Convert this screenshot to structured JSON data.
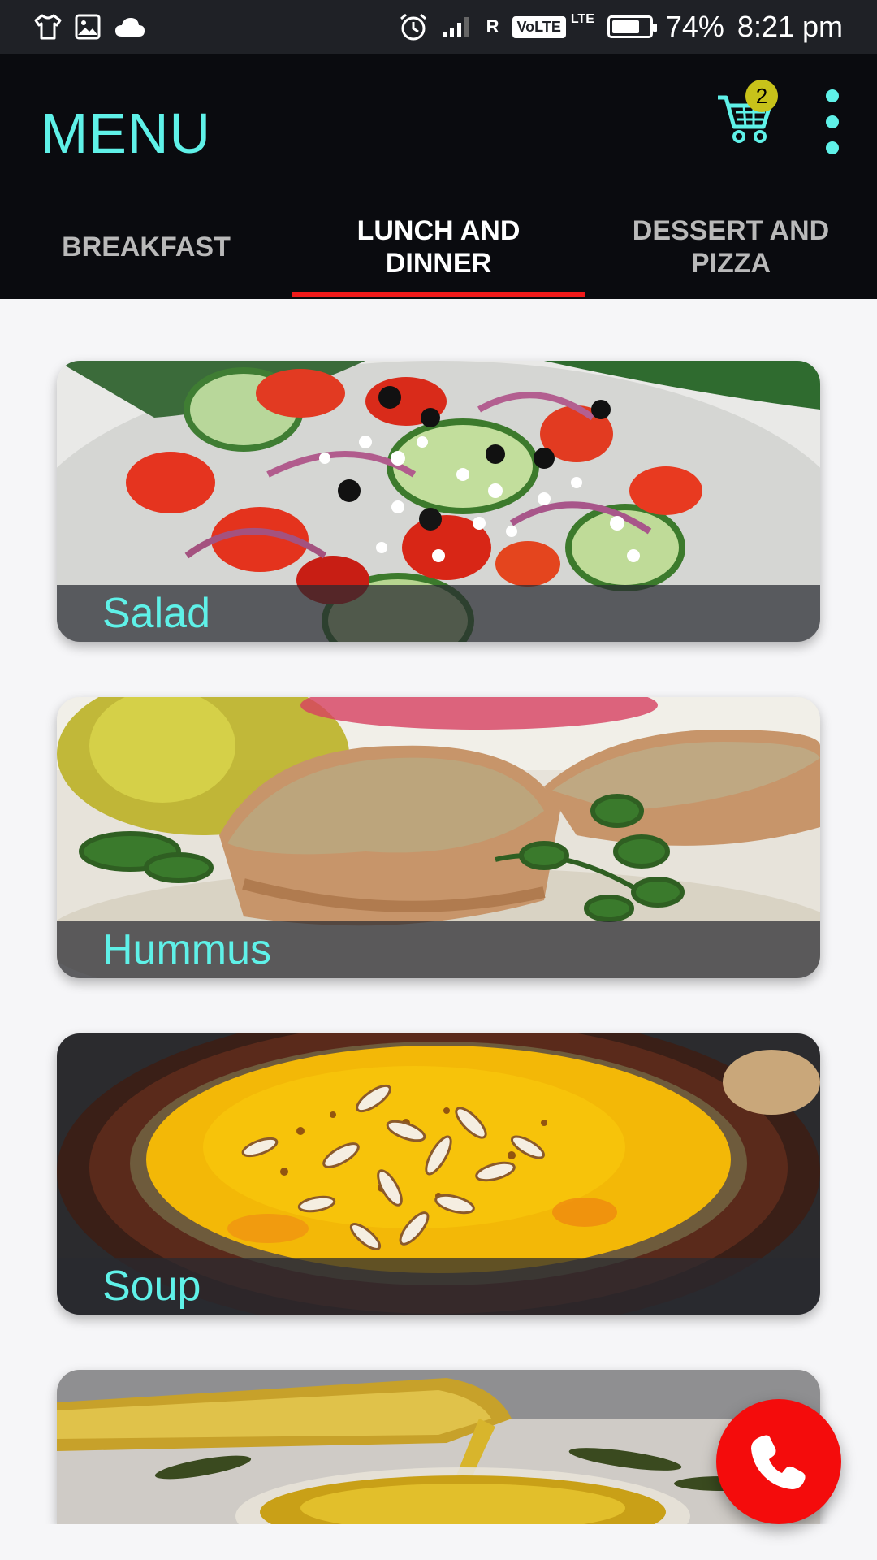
{
  "status_bar": {
    "battery_percent": "74%",
    "time": "8:21 pm",
    "roaming": "R",
    "volte": "VoLTE",
    "lte": "LTE",
    "battery_level": 0.74
  },
  "app_bar": {
    "title": "MENU",
    "cart_badge": "2",
    "accent_color": "#5ff1e8"
  },
  "tabs": [
    {
      "label": "BREAKFAST",
      "active": false
    },
    {
      "label": "LUNCH AND DINNER",
      "active": true
    },
    {
      "label": "DESSERT AND PIZZA",
      "active": false
    }
  ],
  "menu_items": [
    {
      "label": "Salad"
    },
    {
      "label": "Hummus"
    },
    {
      "label": "Soup"
    },
    {
      "label": ""
    }
  ],
  "icons": {
    "shirt": "shirt-icon",
    "image": "image-icon",
    "cloud": "cloud-icon",
    "alarm": "alarm-icon",
    "signal": "signal-icon",
    "battery": "battery-icon",
    "cart": "cart-icon",
    "more": "more-vert-icon",
    "call": "phone-icon"
  },
  "fab_color": "#f40c0c"
}
